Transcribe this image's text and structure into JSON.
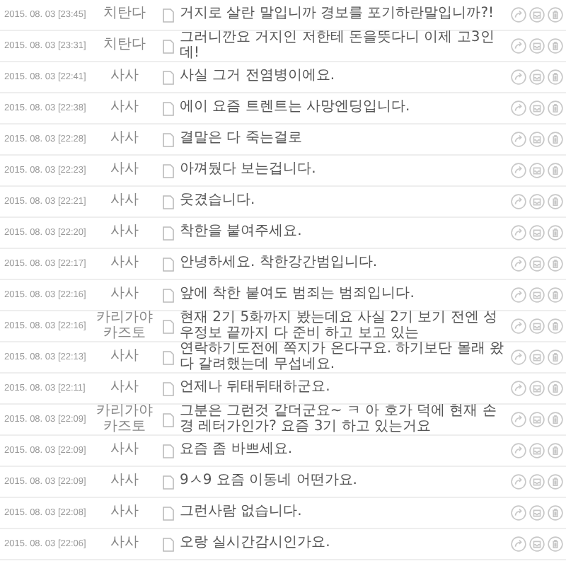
{
  "messages": [
    {
      "date": "2015. 08. 03 [23:45]",
      "author": "치탄다",
      "text": "거지로 살란 말입니까 경보를 포기하란말입니까?!"
    },
    {
      "date": "2015. 08. 03 [23:31]",
      "author": "치탄다",
      "text": "그러니깐요 거지인 저한테 돈을뜻다니 이제 고3인데!"
    },
    {
      "date": "2015. 08. 03 [22:41]",
      "author": "사사",
      "text": "사실 그거 전염병이에요."
    },
    {
      "date": "2015. 08. 03 [22:38]",
      "author": "사사",
      "text": "에이 요즘 트렌트는 사망엔딩입니다."
    },
    {
      "date": "2015. 08. 03 [22:28]",
      "author": "사사",
      "text": "결말은 다 죽는걸로"
    },
    {
      "date": "2015. 08. 03 [22:23]",
      "author": "사사",
      "text": "아껴뒀다 보는겁니다."
    },
    {
      "date": "2015. 08. 03 [22:21]",
      "author": "사사",
      "text": "웃겼습니다."
    },
    {
      "date": "2015. 08. 03 [22:20]",
      "author": "사사",
      "text": "착한을 붙여주세요."
    },
    {
      "date": "2015. 08. 03 [22:17]",
      "author": "사사",
      "text": "안녕하세요. 착한강간범입니다."
    },
    {
      "date": "2015. 08. 03 [22:16]",
      "author": "사사",
      "text": "앞에 착한 붙여도 범죄는 범죄입니다."
    },
    {
      "date": "2015. 08. 03 [22:16]",
      "author": "카리가야 카즈토",
      "text": "현재 2기 5화까지 봤는데요 사실 2기 보기 전엔 성우정보 끝까지 다 준비 하고 보고 있는"
    },
    {
      "date": "2015. 08. 03 [22:13]",
      "author": "사사",
      "text": "연락하기도전에 쪽지가 온다구요. 하기보단 몰래 왔다 갈려했는데 무섭네요."
    },
    {
      "date": "2015. 08. 03 [22:11]",
      "author": "사사",
      "text": "언제나 뒤태뒤태하군요."
    },
    {
      "date": "2015. 08. 03 [22:09]",
      "author": "카리가야 카즈토",
      "text": "그분은 그런것 같더군요~ ㅋ 아 호가 덕에 현재 손경 레터가인가? 요즘 3기 하고 있는거요"
    },
    {
      "date": "2015. 08. 03 [22:09]",
      "author": "사사",
      "text": "요즘 좀 바쁘세요."
    },
    {
      "date": "2015. 08. 03 [22:09]",
      "author": "사사",
      "text": "9ㅅ9 요즘 이동네 어떤가요."
    },
    {
      "date": "2015. 08. 03 [22:08]",
      "author": "사사",
      "text": "그런사람 없습니다."
    },
    {
      "date": "2015. 08. 03 [22:06]",
      "author": "사사",
      "text": "오랑 실시간감시인가요."
    }
  ]
}
